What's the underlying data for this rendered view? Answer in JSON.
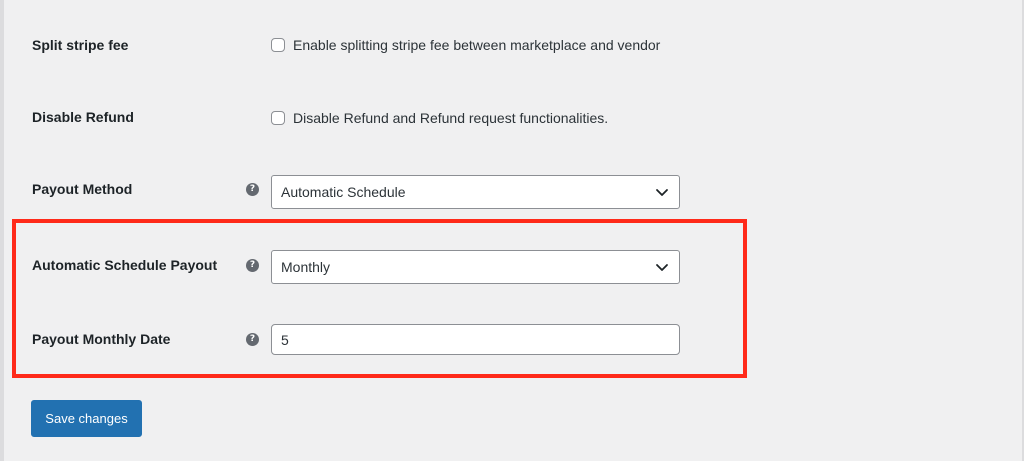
{
  "settings": {
    "split_stripe_fee": {
      "label": "Split stripe fee",
      "checkbox_text": "Enable splitting stripe fee between marketplace and vendor",
      "checked": false
    },
    "disable_refund": {
      "label": "Disable Refund",
      "checkbox_text": "Disable Refund and Refund request functionalities.",
      "checked": false
    },
    "payout_method": {
      "label": "Payout Method",
      "help_icon": "question-mark-icon",
      "selected": "Automatic Schedule"
    },
    "automatic_schedule_payout": {
      "label": "Automatic Schedule Payout",
      "help_icon": "question-mark-icon",
      "selected": "Monthly"
    },
    "payout_monthly_date": {
      "label": "Payout Monthly Date",
      "help_icon": "question-mark-icon",
      "value": "5"
    }
  },
  "help_glyph": "?",
  "save_button": {
    "label": "Save changes"
  },
  "colors": {
    "background": "#f0f0f1",
    "primary_button": "#2271b1",
    "highlight_border": "#ff2a1a",
    "help_icon": "#646970"
  }
}
